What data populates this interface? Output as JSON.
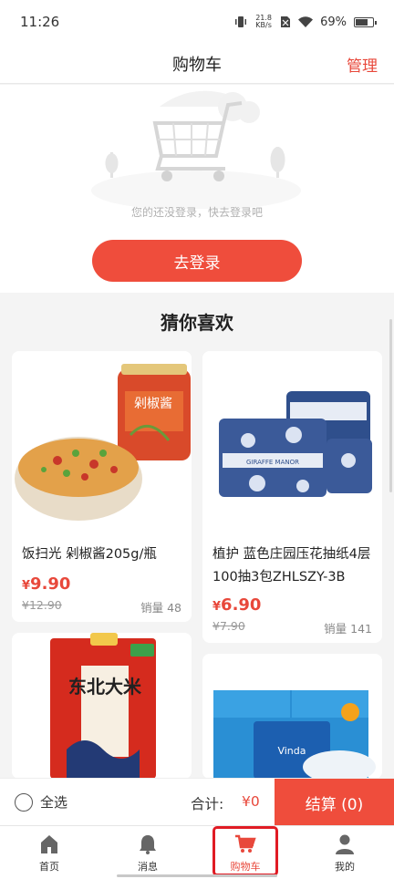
{
  "status_bar": {
    "time": "11:26",
    "speed_value": "21.8",
    "speed_unit": "KB/s",
    "battery": "69%"
  },
  "header": {
    "title": "购物车",
    "manage_label": "管理"
  },
  "login": {
    "hint": "您的还没登录，快去登录吧",
    "button_label": "去登录"
  },
  "recommend": {
    "title": "猜你喜欢",
    "products": [
      {
        "name": "饭扫光 剁椒酱205g/瓶",
        "currency": "¥",
        "price": "9.90",
        "original_price": "¥12.90",
        "sales": "销量 48",
        "jar_label": "剁椒酱"
      },
      {
        "name": "植护 蓝色庄园压花抽纸4层100抽3包ZHLSZY-3B",
        "currency": "¥",
        "price": "6.90",
        "original_price": "¥7.90",
        "sales": "销量 141",
        "brand_text": "GIRAFFE MANOR"
      },
      {
        "name": "",
        "bag_text": "东北大米"
      },
      {
        "name": "",
        "brand_text": "Vinda"
      }
    ]
  },
  "checkout": {
    "select_all_label": "全选",
    "total_label": "合计:",
    "total_value": "¥0",
    "button_label": "结算 (0)"
  },
  "tabbar": {
    "items": [
      {
        "label": "首页",
        "icon": "home-icon"
      },
      {
        "label": "消息",
        "icon": "bell-icon"
      },
      {
        "label": "购物车",
        "icon": "cart-icon"
      },
      {
        "label": "我的",
        "icon": "user-icon"
      }
    ]
  },
  "colors": {
    "accent": "#ef4d3c",
    "price": "#e8483b"
  }
}
